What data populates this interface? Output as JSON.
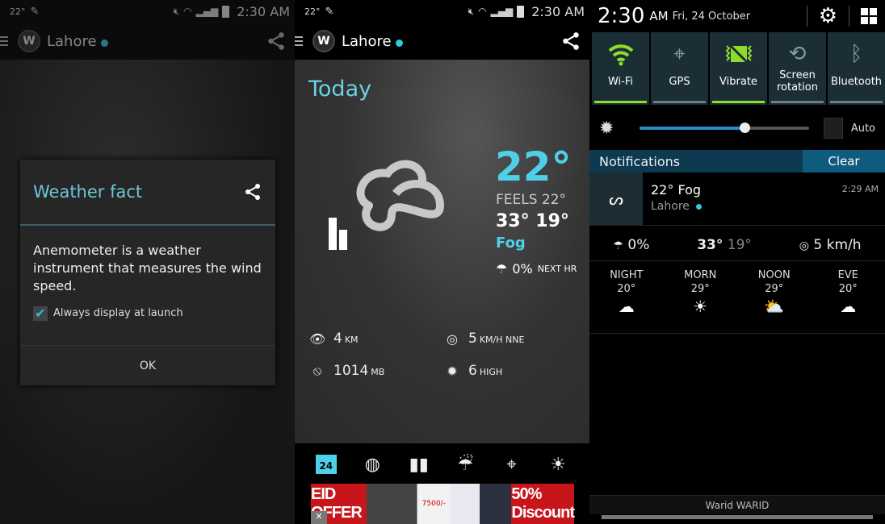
{
  "statusbar": {
    "temp": "22°",
    "time": "2:30 AM"
  },
  "app": {
    "city": "Lahore",
    "logo": "W"
  },
  "dialog": {
    "title": "Weather fact",
    "body": "Anemometer is a weather instrument that measures the wind speed.",
    "checkbox_label": "Always display at launch",
    "checkbox_checked": true,
    "ok_label": "OK"
  },
  "today": {
    "heading": "Today",
    "temp": "22°",
    "feels": "FEELS 22°",
    "hilo": "33° 19°",
    "condition": "Fog",
    "precip_value": "0%",
    "precip_label": "NEXT HR",
    "visibility_value": "4",
    "visibility_unit": "KM",
    "wind_value": "5",
    "wind_unit": "KM/H NNE",
    "pressure_value": "1014",
    "pressure_unit": "MB",
    "uv_value": "6",
    "uv_unit": "HIGH"
  },
  "tabs": [
    {
      "name": "today",
      "label": "24"
    },
    {
      "name": "radar"
    },
    {
      "name": "graphs"
    },
    {
      "name": "precipitation"
    },
    {
      "name": "map"
    },
    {
      "name": "sun"
    }
  ],
  "ad": {
    "left_text": "EID OFFER",
    "price": "7500/-",
    "right_text": "50% Discount",
    "close": "✕"
  },
  "quick": {
    "clock": "2:30",
    "ampm": "AM",
    "date": "Fri, 24 October",
    "toggles": [
      {
        "label": "Wi-Fi",
        "on": true
      },
      {
        "label": "GPS",
        "on": false
      },
      {
        "label": "Vibrate",
        "on": true
      },
      {
        "label": "Screen rotation",
        "on": false
      },
      {
        "label": "Bluetooth",
        "on": false
      }
    ],
    "brightness_percent": 62,
    "auto_label": "Auto"
  },
  "notifications": {
    "header": "Notifications",
    "clear_label": "Clear",
    "item": {
      "title": "22° Fog",
      "subtitle": "Lahore",
      "time": "2:29 AM"
    },
    "precip": "0%",
    "high": "33°",
    "low": "19°",
    "wind": "5 km/h",
    "periods": [
      {
        "label": "NIGHT",
        "temp": "20°",
        "icon": "night-cloud-icon"
      },
      {
        "label": "MORN",
        "temp": "29°",
        "icon": "sun-icon"
      },
      {
        "label": "NOON",
        "temp": "29°",
        "icon": "partly-cloudy-icon"
      },
      {
        "label": "EVE",
        "temp": "20°",
        "icon": "evening-cloud-icon"
      }
    ],
    "carrier": "Warid WARID"
  },
  "colors": {
    "accent": "#4fd0e8",
    "toggle_on": "#8fdc29",
    "notif_header": "#0d3a50",
    "clear": "#0f5b7d"
  }
}
